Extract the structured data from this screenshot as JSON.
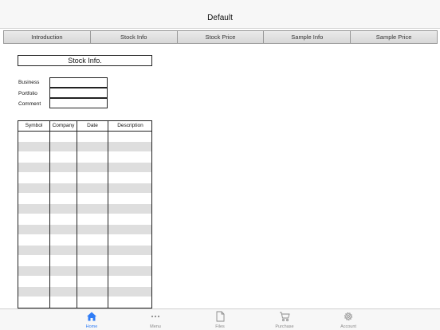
{
  "navbar": {
    "title": "Default"
  },
  "tabs": [
    {
      "label": "Introduction"
    },
    {
      "label": "Stock Info"
    },
    {
      "label": "Stock Price"
    },
    {
      "label": "Sample Info"
    },
    {
      "label": "Sample Price"
    }
  ],
  "form": {
    "title": "Stock Info.",
    "business_label": "Business",
    "portfolio_label": "Portfolio",
    "comment_label": "Comment",
    "business_value": "",
    "portfolio_value": "",
    "comment_value": ""
  },
  "grid": {
    "columns": [
      "Symbol",
      "Company",
      "Date",
      "Description"
    ]
  },
  "tabbar": {
    "items": [
      {
        "label": "Home",
        "icon": "home-icon",
        "active": true
      },
      {
        "label": "Menu",
        "icon": "more-icon"
      },
      {
        "label": "Files",
        "icon": "file-icon"
      },
      {
        "label": "Purchase",
        "icon": "cart-icon"
      },
      {
        "label": "Account",
        "icon": "gear-icon"
      }
    ]
  },
  "colors": {
    "accent": "#2f7cf6",
    "stripe": "#dedede"
  }
}
